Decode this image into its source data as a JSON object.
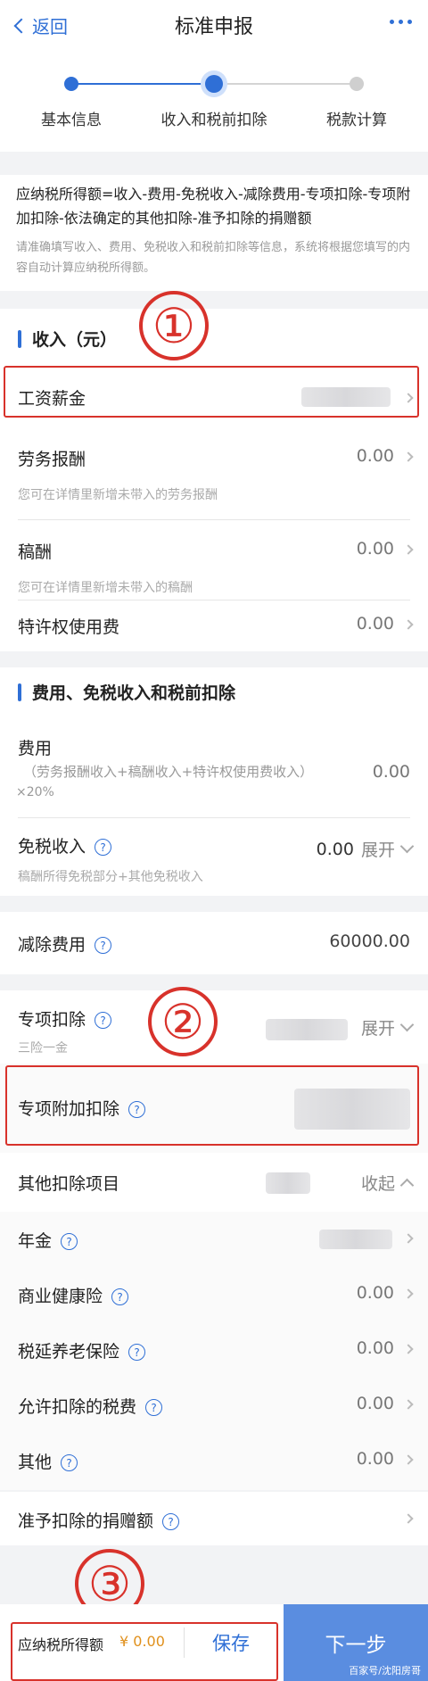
{
  "header": {
    "back_label": "返回",
    "title": "标准申报"
  },
  "steps": [
    {
      "label": "基本信息"
    },
    {
      "label": "收入和税前扣除"
    },
    {
      "label": "税款计算"
    }
  ],
  "formula": {
    "text": "应纳税所得额=收入-费用-免税收入-减除费用-专项扣除-专项附加扣除-依法确定的其他扣除-准予扣除的捐赠额",
    "note": "请准确填写收入、费用、免税收入和税前扣除等信息，系统将根据您填写的内容自动计算应纳税所得额。"
  },
  "income": {
    "title": "收入（元）",
    "salary": {
      "label": "工资薪金"
    },
    "labor": {
      "label": "劳务报酬",
      "value": "0.00",
      "hint": "您可在详情里新增未带入的劳务报酬"
    },
    "royalty": {
      "label": "稿酬",
      "value": "0.00",
      "hint": "您可在详情里新增未带入的稿酬"
    },
    "franchise": {
      "label": "特许权使用费",
      "value": "0.00"
    }
  },
  "deductions": {
    "title": "费用、免税收入和税前扣除",
    "expense": {
      "label": "费用",
      "formula": "（劳务报酬收入+稿酬收入+特许权使用费收入）",
      "suffix": "×20%",
      "value": "0.00"
    },
    "taxfree": {
      "label": "免税收入",
      "value": "0.00",
      "expand": "展开",
      "hint": "稿酬所得免税部分+其他免税收入"
    }
  },
  "reduction": {
    "label": "减除费用",
    "value": "60000.00"
  },
  "special": {
    "label": "专项扣除",
    "hint": "三险一金",
    "expand": "展开",
    "additional": {
      "label": "专项附加扣除"
    },
    "other": {
      "label": "其他扣除项目",
      "collapse": "收起",
      "items": [
        {
          "label": "年金",
          "value": ""
        },
        {
          "label": "商业健康险",
          "value": "0.00"
        },
        {
          "label": "税延养老保险",
          "value": "0.00"
        },
        {
          "label": "允许扣除的税费",
          "value": "0.00"
        },
        {
          "label": "其他",
          "value": "0.00"
        }
      ]
    }
  },
  "donation": {
    "label": "准予扣除的捐赠额"
  },
  "annotations": [
    "①",
    "②",
    "③"
  ],
  "bottom": {
    "taxable_label": "应纳税所得额",
    "taxable_value": "¥ 0.00",
    "save_label": "保存",
    "next_label": "下一步",
    "watermark": "百家号/沈阳房哥"
  },
  "colors": {
    "accent": "#2f6fd6",
    "annotation": "#d8322b",
    "amount": "#e0901c",
    "next_bg": "#5a8de0"
  }
}
